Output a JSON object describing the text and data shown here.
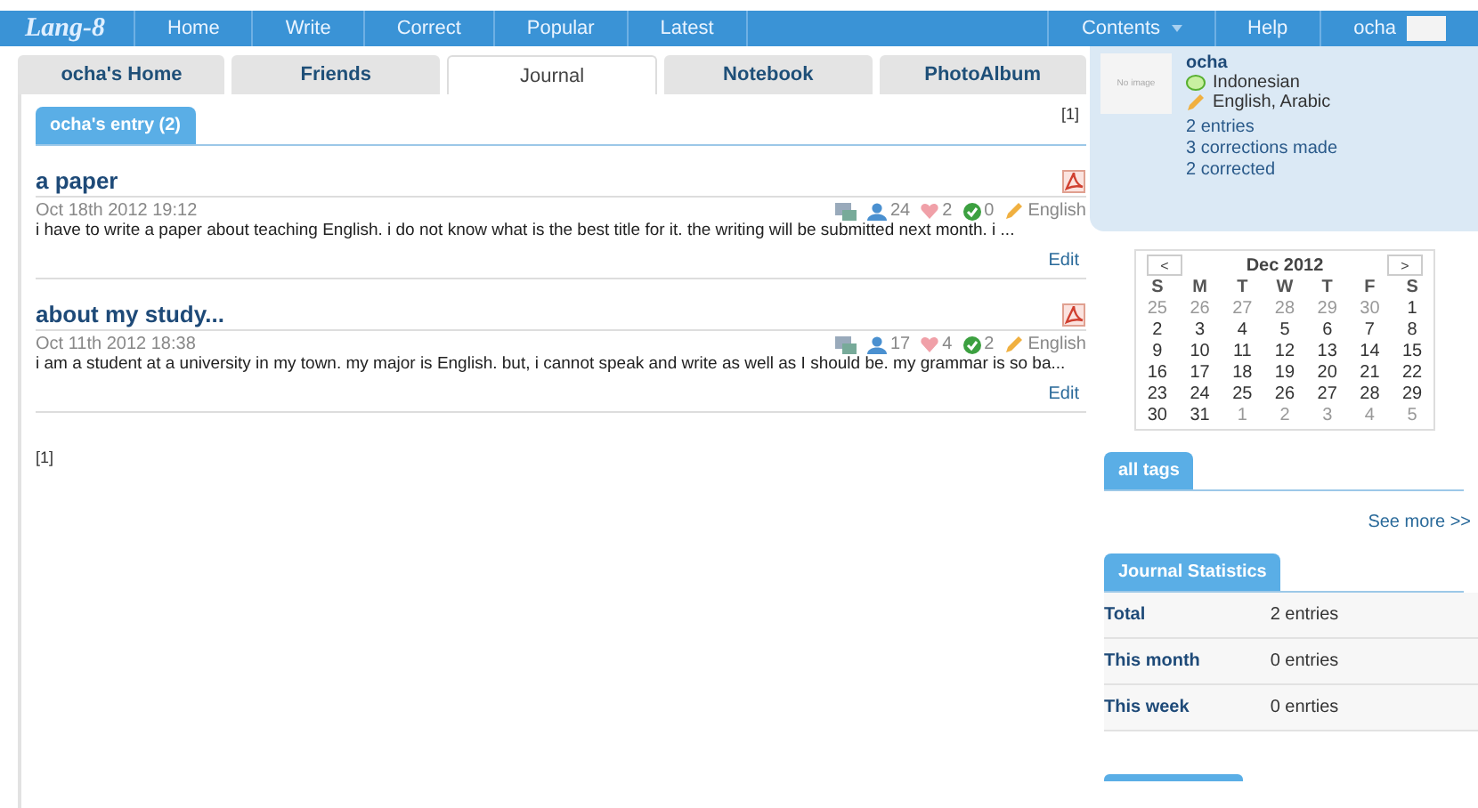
{
  "nav": {
    "logo": "Lang-8",
    "items": [
      "Home",
      "Write",
      "Correct",
      "Popular",
      "Latest"
    ],
    "right": [
      {
        "label": "Contents",
        "kind": "dropdown"
      },
      {
        "label": "Help",
        "kind": "link"
      },
      {
        "label": "ocha",
        "kind": "user"
      }
    ]
  },
  "tabs": [
    {
      "label": "ocha's Home",
      "selected": false
    },
    {
      "label": "Friends",
      "selected": false
    },
    {
      "label": "Journal",
      "selected": true
    },
    {
      "label": "Notebook",
      "selected": false
    },
    {
      "label": "PhotoAlbum",
      "selected": false
    }
  ],
  "section": {
    "title": "ocha's entry (2)",
    "pager_top": "[1]",
    "pager_bottom": "[1]"
  },
  "entries": [
    {
      "title": "a paper",
      "date": "Oct 18th 2012 19:12",
      "views": "24",
      "likes": "2",
      "corrections": "0",
      "language": "English",
      "excerpt": "i have to write a paper about teaching English. i do not know what is the best title for it. the writing will be submitted next month. i ...",
      "edit": "Edit"
    },
    {
      "title": "about my study...",
      "date": "Oct 11th 2012 18:38",
      "views": "17",
      "likes": "4",
      "corrections": "2",
      "language": "English",
      "excerpt": "i am a student at a university in my town. my major is English. but, i cannot speak and write as well as I should be. my grammar is so ba...",
      "edit": "Edit"
    }
  ],
  "profile": {
    "avatar": "No image",
    "name": "ocha",
    "native": "Indonesian",
    "learning": "English, Arabic",
    "stats": [
      "2 entries",
      "3 corrections made",
      "2 corrected"
    ]
  },
  "calendar": {
    "prev": "<",
    "month": "Dec 2012",
    "next": ">",
    "weekdays": [
      "S",
      "M",
      "T",
      "W",
      "T",
      "F",
      "S"
    ],
    "weeks": [
      [
        {
          "d": "25",
          "other": true
        },
        {
          "d": "26",
          "other": true
        },
        {
          "d": "27",
          "other": true
        },
        {
          "d": "28",
          "other": true
        },
        {
          "d": "29",
          "other": true
        },
        {
          "d": "30",
          "other": true
        },
        {
          "d": "1",
          "other": false
        }
      ],
      [
        {
          "d": "2",
          "other": false
        },
        {
          "d": "3",
          "other": false
        },
        {
          "d": "4",
          "other": false
        },
        {
          "d": "5",
          "other": false
        },
        {
          "d": "6",
          "other": false
        },
        {
          "d": "7",
          "other": false
        },
        {
          "d": "8",
          "other": false
        }
      ],
      [
        {
          "d": "9",
          "other": false
        },
        {
          "d": "10",
          "other": false
        },
        {
          "d": "11",
          "other": false
        },
        {
          "d": "12",
          "other": false
        },
        {
          "d": "13",
          "other": false
        },
        {
          "d": "14",
          "other": false
        },
        {
          "d": "15",
          "other": false
        }
      ],
      [
        {
          "d": "16",
          "other": false
        },
        {
          "d": "17",
          "other": false
        },
        {
          "d": "18",
          "other": false
        },
        {
          "d": "19",
          "other": false
        },
        {
          "d": "20",
          "other": false
        },
        {
          "d": "21",
          "other": false
        },
        {
          "d": "22",
          "other": false
        }
      ],
      [
        {
          "d": "23",
          "other": false
        },
        {
          "d": "24",
          "other": false
        },
        {
          "d": "25",
          "other": false
        },
        {
          "d": "26",
          "other": false
        },
        {
          "d": "27",
          "other": false
        },
        {
          "d": "28",
          "other": false
        },
        {
          "d": "29",
          "other": false
        }
      ],
      [
        {
          "d": "30",
          "other": false
        },
        {
          "d": "31",
          "other": false
        },
        {
          "d": "1",
          "other": true
        },
        {
          "d": "2",
          "other": true
        },
        {
          "d": "3",
          "other": true
        },
        {
          "d": "4",
          "other": true
        },
        {
          "d": "5",
          "other": true
        }
      ]
    ]
  },
  "tags": {
    "title": "all tags",
    "see_more": "See more >>"
  },
  "journal_stats": {
    "title": "Journal Statistics",
    "rows": [
      {
        "label": "Total",
        "value": "2 entries"
      },
      {
        "label": "This month",
        "value": "0 entries"
      },
      {
        "label": "This week",
        "value": "0 enrties"
      }
    ]
  }
}
